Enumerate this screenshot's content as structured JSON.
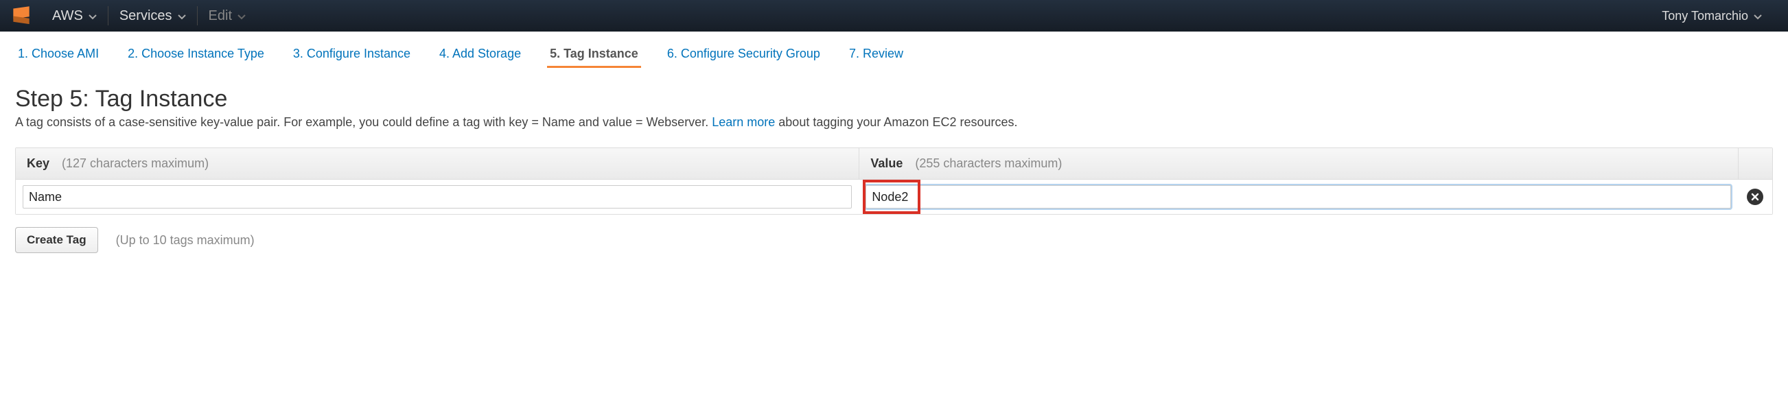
{
  "navbar": {
    "aws_label": "AWS",
    "services_label": "Services",
    "edit_label": "Edit",
    "user_name": "Tony Tomarchio"
  },
  "wizard": {
    "steps": [
      {
        "label": "1. Choose AMI",
        "active": false
      },
      {
        "label": "2. Choose Instance Type",
        "active": false
      },
      {
        "label": "3. Configure Instance",
        "active": false
      },
      {
        "label": "4. Add Storage",
        "active": false
      },
      {
        "label": "5. Tag Instance",
        "active": true
      },
      {
        "label": "6. Configure Security Group",
        "active": false
      },
      {
        "label": "7. Review",
        "active": false
      }
    ]
  },
  "page": {
    "title": "Step 5: Tag Instance",
    "desc_prefix": "A tag consists of a case-sensitive key-value pair. For example, you could define a tag with key = Name and value = Webserver. ",
    "learn_more": "Learn more",
    "desc_suffix": " about tagging your Amazon EC2 resources."
  },
  "table": {
    "key_header": "Key",
    "key_note": "(127 characters maximum)",
    "value_header": "Value",
    "value_note": "(255 characters maximum)",
    "rows": [
      {
        "key": "Name",
        "value": "Node2"
      }
    ]
  },
  "footer": {
    "create_tag": "Create Tag",
    "limit_note": "(Up to 10 tags maximum)"
  },
  "colors": {
    "link": "#0073bb",
    "active_underline": "#f58536",
    "highlight_border": "#d93025"
  }
}
